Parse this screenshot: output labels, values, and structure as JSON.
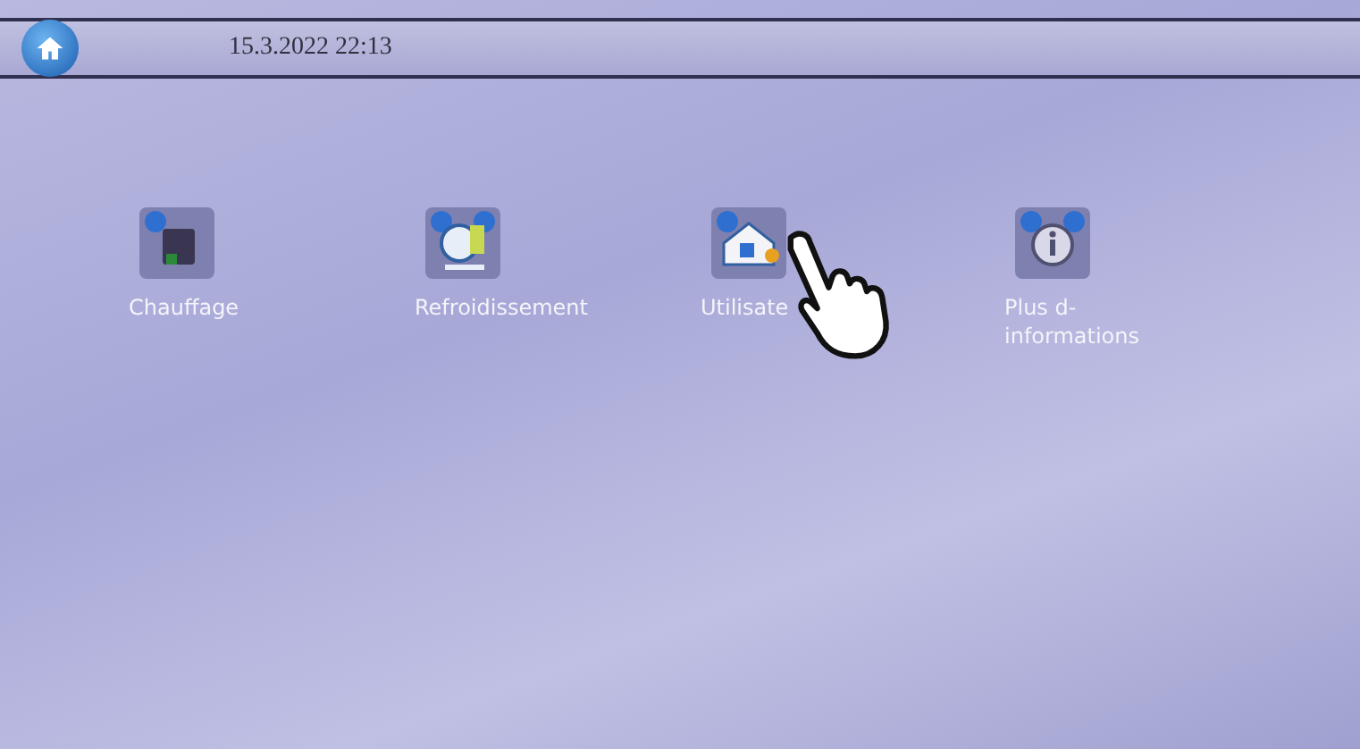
{
  "top_bar": {
    "datetime": "15.3.2022 22:13"
  },
  "menu_items": [
    {
      "kind": "heating",
      "label": "Chauffage"
    },
    {
      "kind": "cooling",
      "label": "Refroidissement"
    },
    {
      "kind": "user",
      "label": "Utilisate"
    },
    {
      "kind": "info",
      "label": "Plus d-\ninformations"
    }
  ]
}
